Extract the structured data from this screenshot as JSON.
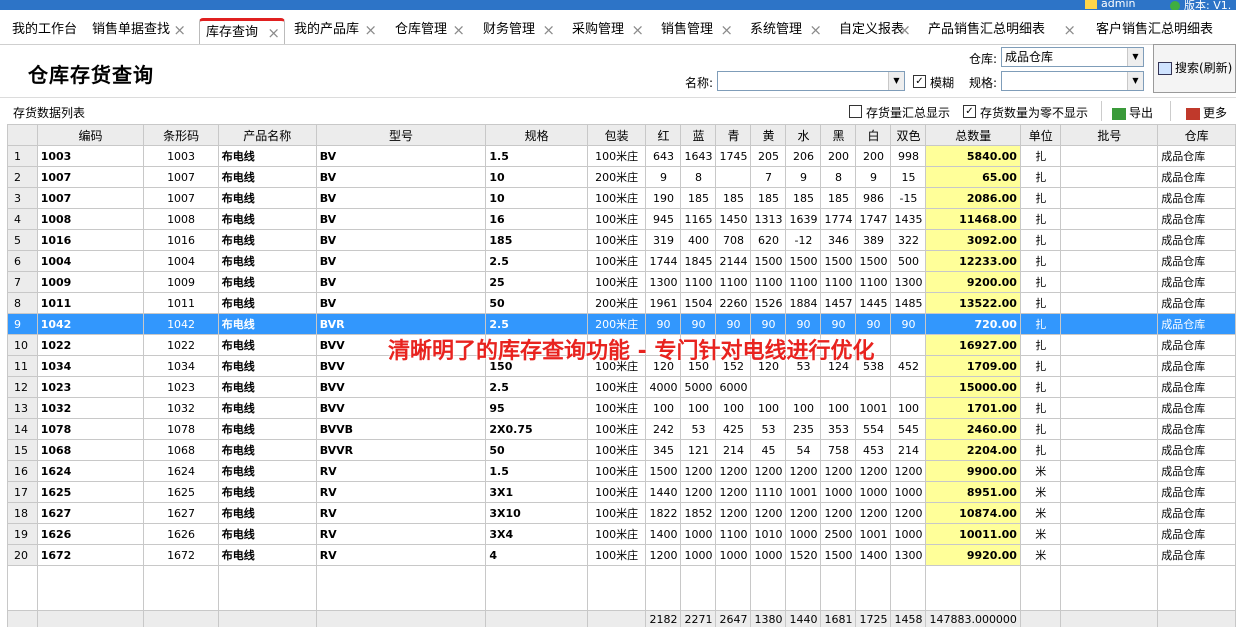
{
  "top": {
    "user": "admin",
    "version": "版本: V1."
  },
  "tabs": [
    {
      "label": "我的工作台",
      "closable": false
    },
    {
      "label": "销售单据查找",
      "closable": true
    },
    {
      "label": "库存查询",
      "closable": true,
      "active": true
    },
    {
      "label": "我的产品库",
      "closable": true
    },
    {
      "label": "仓库管理",
      "closable": true
    },
    {
      "label": "财务管理",
      "closable": true
    },
    {
      "label": "采购管理",
      "closable": true
    },
    {
      "label": "销售管理",
      "closable": true
    },
    {
      "label": "系统管理",
      "closable": true
    },
    {
      "label": "自定义报表",
      "closable": true
    },
    {
      "label": "产品销售汇总明细表",
      "closable": true
    },
    {
      "label": "客户销售汇总明细表",
      "closable": false
    }
  ],
  "page": {
    "title": "仓库存货查询"
  },
  "filters": {
    "warehouse_label": "仓库:",
    "warehouse_value": "成品仓库",
    "name_label": "名称:",
    "name_value": "",
    "fuzzy_label": "模糊",
    "fuzzy_checked": true,
    "spec_label": "规格:",
    "spec_value": ""
  },
  "search_button": "搜索(刷新)",
  "toolbar": {
    "list_title": "存货数据列表",
    "opt_summary": "存货量汇总显示",
    "opt_summary_checked": false,
    "opt_hide_zero": "存货数量为零不显示",
    "opt_hide_zero_checked": true,
    "export": "导出",
    "more": "更多"
  },
  "table": {
    "columns": [
      "",
      "编码",
      "条形码",
      "产品名称",
      "型号",
      "规格",
      "包装",
      "红",
      "蓝",
      "青",
      "黄",
      "水",
      "黑",
      "白",
      "双色",
      "总数量",
      "单位",
      "批号",
      "仓库"
    ],
    "rows": [
      [
        "1",
        "1003",
        "1003",
        "布电线",
        "BV",
        "1.5",
        "100米庄",
        "643",
        "1643",
        "1745",
        "205",
        "206",
        "200",
        "200",
        "998",
        "5840.00",
        "扎",
        "",
        "成品仓库"
      ],
      [
        "2",
        "1007",
        "1007",
        "布电线",
        "BV",
        "10",
        "200米庄",
        "9",
        "8",
        "",
        "7",
        "9",
        "8",
        "9",
        "15",
        "65.00",
        "扎",
        "",
        "成品仓库"
      ],
      [
        "3",
        "1007",
        "1007",
        "布电线",
        "BV",
        "10",
        "100米庄",
        "190",
        "185",
        "185",
        "185",
        "185",
        "185",
        "986",
        "-15",
        "2086.00",
        "扎",
        "",
        "成品仓库"
      ],
      [
        "4",
        "1008",
        "1008",
        "布电线",
        "BV",
        "16",
        "100米庄",
        "945",
        "1165",
        "1450",
        "1313",
        "1639",
        "1774",
        "1747",
        "1435",
        "11468.00",
        "扎",
        "",
        "成品仓库"
      ],
      [
        "5",
        "1016",
        "1016",
        "布电线",
        "BV",
        "185",
        "100米庄",
        "319",
        "400",
        "708",
        "620",
        "-12",
        "346",
        "389",
        "322",
        "3092.00",
        "扎",
        "",
        "成品仓库"
      ],
      [
        "6",
        "1004",
        "1004",
        "布电线",
        "BV",
        "2.5",
        "100米庄",
        "1744",
        "1845",
        "2144",
        "1500",
        "1500",
        "1500",
        "1500",
        "500",
        "12233.00",
        "扎",
        "",
        "成品仓库"
      ],
      [
        "7",
        "1009",
        "1009",
        "布电线",
        "BV",
        "25",
        "100米庄",
        "1300",
        "1100",
        "1100",
        "1100",
        "1100",
        "1100",
        "1100",
        "1300",
        "9200.00",
        "扎",
        "",
        "成品仓库"
      ],
      [
        "8",
        "1011",
        "1011",
        "布电线",
        "BV",
        "50",
        "200米庄",
        "1961",
        "1504",
        "2260",
        "1526",
        "1884",
        "1457",
        "1445",
        "1485",
        "13522.00",
        "扎",
        "",
        "成品仓库"
      ],
      [
        "9",
        "1042",
        "1042",
        "布电线",
        "BVR",
        "2.5",
        "200米庄",
        "90",
        "90",
        "90",
        "90",
        "90",
        "90",
        "90",
        "90",
        "720.00",
        "扎",
        "",
        "成品仓库"
      ],
      [
        "10",
        "1022",
        "1022",
        "布电线",
        "BVV",
        "",
        "",
        "",
        "",
        "",
        "",
        "",
        "",
        "",
        "",
        "16927.00",
        "扎",
        "",
        "成品仓库"
      ],
      [
        "11",
        "1034",
        "1034",
        "布电线",
        "BVV",
        "150",
        "100米庄",
        "120",
        "150",
        "152",
        "120",
        "53",
        "124",
        "538",
        "452",
        "1709.00",
        "扎",
        "",
        "成品仓库"
      ],
      [
        "12",
        "1023",
        "1023",
        "布电线",
        "BVV",
        "2.5",
        "100米庄",
        "4000",
        "5000",
        "6000",
        "",
        "",
        "",
        "",
        "",
        "15000.00",
        "扎",
        "",
        "成品仓库"
      ],
      [
        "13",
        "1032",
        "1032",
        "布电线",
        "BVV",
        "95",
        "100米庄",
        "100",
        "100",
        "100",
        "100",
        "100",
        "100",
        "1001",
        "100",
        "1701.00",
        "扎",
        "",
        "成品仓库"
      ],
      [
        "14",
        "1078",
        "1078",
        "布电线",
        "BVVB",
        "2X0.75",
        "100米庄",
        "242",
        "53",
        "425",
        "53",
        "235",
        "353",
        "554",
        "545",
        "2460.00",
        "扎",
        "",
        "成品仓库"
      ],
      [
        "15",
        "1068",
        "1068",
        "布电线",
        "BVVR",
        "50",
        "100米庄",
        "345",
        "121",
        "214",
        "45",
        "54",
        "758",
        "453",
        "214",
        "2204.00",
        "扎",
        "",
        "成品仓库"
      ],
      [
        "16",
        "1624",
        "1624",
        "布电线",
        "RV",
        "1.5",
        "100米庄",
        "1500",
        "1200",
        "1200",
        "1200",
        "1200",
        "1200",
        "1200",
        "1200",
        "9900.00",
        "米",
        "",
        "成品仓库"
      ],
      [
        "17",
        "1625",
        "1625",
        "布电线",
        "RV",
        "3X1",
        "100米庄",
        "1440",
        "1200",
        "1200",
        "1110",
        "1001",
        "1000",
        "1000",
        "1000",
        "8951.00",
        "米",
        "",
        "成品仓库"
      ],
      [
        "18",
        "1627",
        "1627",
        "布电线",
        "RV",
        "3X10",
        "100米庄",
        "1822",
        "1852",
        "1200",
        "1200",
        "1200",
        "1200",
        "1200",
        "1200",
        "10874.00",
        "米",
        "",
        "成品仓库"
      ],
      [
        "19",
        "1626",
        "1626",
        "布电线",
        "RV",
        "3X4",
        "100米庄",
        "1400",
        "1000",
        "1100",
        "1010",
        "1000",
        "2500",
        "1001",
        "1000",
        "10011.00",
        "米",
        "",
        "成品仓库"
      ],
      [
        "20",
        "1672",
        "1672",
        "布电线",
        "RV",
        "4",
        "100米庄",
        "1200",
        "1000",
        "1000",
        "1000",
        "1520",
        "1500",
        "1400",
        "1300",
        "9920.00",
        "米",
        "",
        "成品仓库"
      ]
    ],
    "selected_row": 9,
    "summary": [
      "",
      "",
      "",
      "",
      "",
      "",
      "",
      "2182",
      "2271",
      "2647",
      "1380",
      "1440",
      "1681",
      "1725",
      "1458",
      "147883.000000",
      "",
      "",
      ""
    ]
  },
  "overlay_text": "清晰明了的库存查询功能 - 专门针对电线进行优化",
  "colors": {
    "selected": "#3297fd",
    "total_cell": "#ffff99",
    "active_tab_accent": "#e02020",
    "overlay": "#e8231f"
  }
}
